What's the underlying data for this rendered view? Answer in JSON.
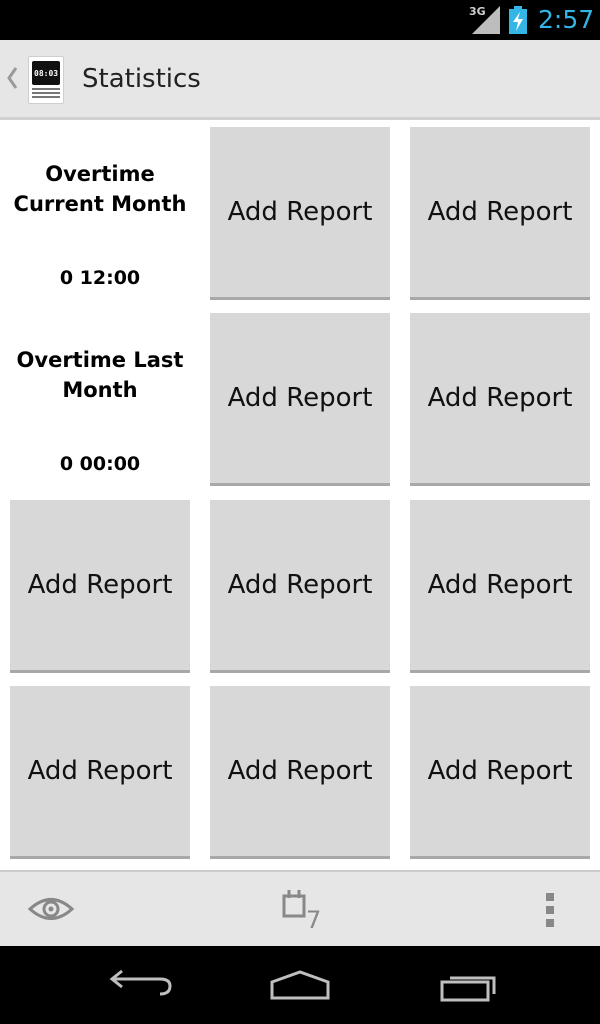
{
  "status_bar": {
    "network": "3G",
    "time": "2:57",
    "clock_color": "#33b5e5"
  },
  "action_bar": {
    "title": "Statistics",
    "app_icon": {
      "date": "2011-09-01",
      "time": "08:03"
    }
  },
  "stats": [
    {
      "title": "Overtime Current Month",
      "value": "0 12:00"
    },
    {
      "title": "Overtime Last Month",
      "value": "0 00:00"
    }
  ],
  "report_buttons": {
    "label": "Add Report"
  },
  "bottom_bar": {
    "left_icon": "eye-icon",
    "center_icon": "calendar-icon",
    "center_badge": "7",
    "right_icon": "overflow-menu-icon"
  },
  "nav_bar": {
    "icons": [
      "back-icon",
      "home-icon",
      "recent-apps-icon"
    ]
  }
}
